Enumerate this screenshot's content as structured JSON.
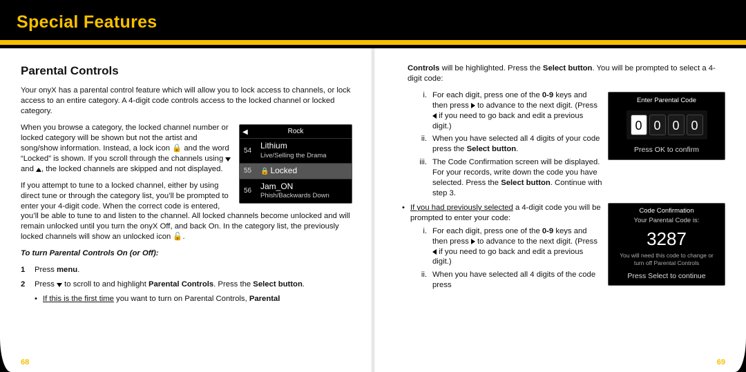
{
  "header": {
    "title": "Special Features"
  },
  "pages": {
    "left": "68",
    "right": "69"
  },
  "left": {
    "section_heading": "Parental Controls",
    "p1": "Your onyX has a parental control feature which will allow you to lock access to channels, or lock access to an entire category. A 4-digit code controls access to the locked channel or locked category.",
    "p2a": "When you browse a category, the locked channel number or locked category will be shown but not the artist and song/show information. Instead, a lock icon ",
    "p2b": " and the word “Locked” is shown. If you scroll through the channels using ",
    "p2c": " and ",
    "p2d": ", the locked channels are skipped and not displayed.",
    "p3a": "If you attempt to tune to a locked channel, either by using direct tune or through the category list, you’ll be prompted to enter your 4-digit code. When the correct code is entered, you’ll be able to tune to and listen to the channel. All locked channels become unlocked and will remain unlocked until you turn the onyX Off, and back On. In the category list, the previously locked channels will show an unlocked icon ",
    "p3b": ".",
    "instr_head": "To turn Parental Controls On (or Off):",
    "step1_n": "1",
    "step1_pre": "Press ",
    "step1_bold": "menu",
    "step1_post": ".",
    "step2_n": "2",
    "step2_pre": "Press ",
    "step2_mid1": " to scroll to and highlight ",
    "step2_bold1": "Parental Controls",
    "step2_mid2": ". Press the ",
    "step2_bold2": "Select button",
    "step2_post": ".",
    "sub_pre": "If this is the first time",
    "sub_mid": " you want to turn on Parental Controls, ",
    "sub_bold": "Parental",
    "chan": {
      "category": "Rock",
      "r1_num": "54",
      "r1_name": "Lithium",
      "r1_sub": "Live/Selling the Drama",
      "r2_num": "55",
      "r2_name": "Locked",
      "r3_num": "56",
      "r3_name": "Jam_ON",
      "r3_sub": "Phish/Backwards Down"
    }
  },
  "right": {
    "cont_bold1": "Controls",
    "cont_mid1": " will be highlighted. Press the ",
    "cont_bold2": "Select button",
    "cont_mid2": ". You will be prompted to select a 4-digit code:",
    "i1a": "For each digit, press one of the ",
    "i1_bold": "0-9",
    "i1b": " keys and then press ",
    "i1c": " to advance to the next digit. (Press ",
    "i1d": " if you need to go back and edit a previous digit.)",
    "i2a": "When you have selected all 4 digits of your code press the ",
    "i2_bold": "Select button",
    "i2b": ".",
    "i3a": "The Code Confirmation screen will be displayed. For your records, write down the code you have selected. Press the ",
    "i3_bold": "Select button",
    "i3b": ". Continue with step 3.",
    "prev_pre": "If you had previously selected",
    "prev_post": " a 4-digit code you will be prompted to enter your code:",
    "j1a": "For each digit, press one of the ",
    "j1_bold": "0-9",
    "j1b": " keys and then press ",
    "j1c": " to advance to the next digit. (Press ",
    "j1d": " if you need to go back and edit a previous digit.)",
    "j2": "When you have selected all 4 digits of the code press",
    "codeScreen": {
      "title": "Enter Parental Code",
      "d1": "0",
      "d2": "0",
      "d3": "0",
      "d4": "0",
      "hint": "Press OK to confirm"
    },
    "confScreen": {
      "title": "Code Confirmation",
      "sub": "Your Parental Code is:",
      "code": "3287",
      "note": "You will need this code to change or turn off Parental Controls",
      "press": "Press Select to continue"
    }
  }
}
